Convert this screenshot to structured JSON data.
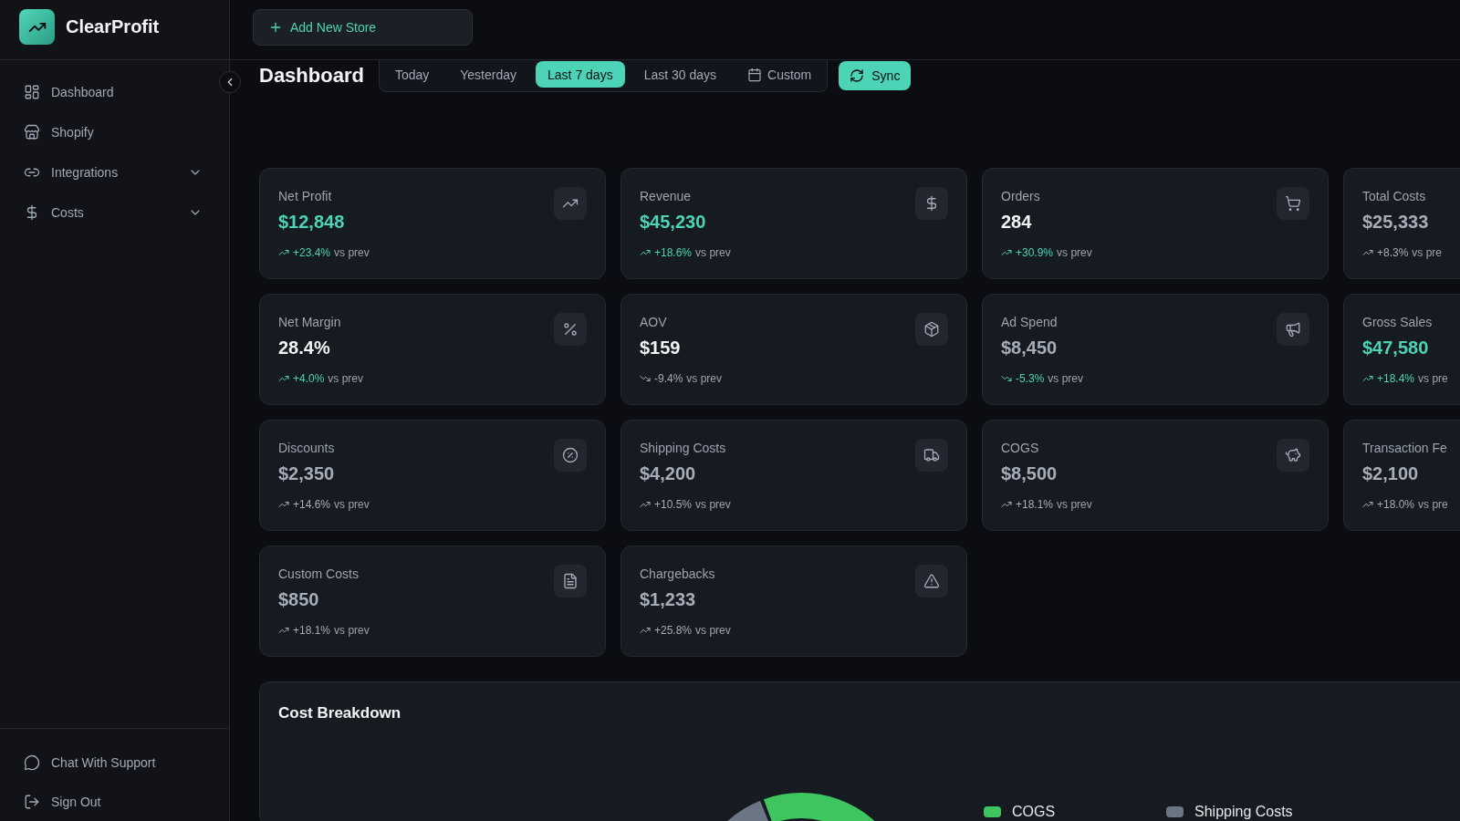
{
  "sidebar": {
    "brand": "ClearProfit",
    "nav": [
      {
        "label": "Dashboard",
        "kind": "link"
      },
      {
        "label": "Shopify",
        "kind": "link"
      },
      {
        "label": "Integrations",
        "kind": "group",
        "expanded": false
      },
      {
        "label": "Costs",
        "kind": "group",
        "expanded": false
      }
    ],
    "footer": [
      {
        "label": "Chat With Support"
      },
      {
        "label": "Sign Out"
      }
    ]
  },
  "header": {
    "add_store_button": "Add New Store"
  },
  "toolbar": {
    "title": "Dashboard",
    "ranges": [
      {
        "label": "Today",
        "kind": "preset",
        "selected": false
      },
      {
        "label": "Yesterday",
        "kind": "preset",
        "selected": false
      },
      {
        "label": "Last 7 days",
        "kind": "preset",
        "selected": true
      },
      {
        "label": "Last 30 days",
        "kind": "preset",
        "selected": false
      },
      {
        "label": "Custom",
        "kind": "custom",
        "selected": false
      }
    ],
    "sync_button": "Sync"
  },
  "metrics": [
    {
      "label": "Net Profit",
      "value": "$12,848",
      "highlighted": true,
      "dimmed": false,
      "change": "+23.4%",
      "rising": true,
      "favorable": true,
      "suffix": "vs prev"
    },
    {
      "label": "Revenue",
      "value": "$45,230",
      "highlighted": true,
      "dimmed": false,
      "change": "+18.6%",
      "rising": true,
      "favorable": true,
      "suffix": "vs prev"
    },
    {
      "label": "Orders",
      "value": "284",
      "highlighted": false,
      "dimmed": false,
      "change": "+30.9%",
      "rising": true,
      "favorable": true,
      "suffix": "vs prev"
    },
    {
      "label": "Total Costs",
      "value": "$25,333",
      "highlighted": false,
      "dimmed": true,
      "change": "+8.3%",
      "rising": true,
      "favorable": false,
      "suffix": "vs pre"
    },
    {
      "label": "Net Margin",
      "value": "28.4%",
      "highlighted": false,
      "dimmed": false,
      "change": "+4.0%",
      "rising": true,
      "favorable": true,
      "suffix": "vs prev"
    },
    {
      "label": "AOV",
      "value": "$159",
      "highlighted": false,
      "dimmed": false,
      "change": "-9.4%",
      "rising": false,
      "favorable": false,
      "suffix": "vs prev"
    },
    {
      "label": "Ad Spend",
      "value": "$8,450",
      "highlighted": false,
      "dimmed": true,
      "change": "-5.3%",
      "rising": false,
      "favorable": true,
      "suffix": "vs prev"
    },
    {
      "label": "Gross Sales",
      "value": "$47,580",
      "highlighted": true,
      "dimmed": false,
      "change": "+18.4%",
      "rising": true,
      "favorable": true,
      "suffix": "vs pre"
    },
    {
      "label": "Discounts",
      "value": "$2,350",
      "highlighted": false,
      "dimmed": true,
      "change": "+14.6%",
      "rising": true,
      "favorable": false,
      "suffix": "vs prev"
    },
    {
      "label": "Shipping Costs",
      "value": "$4,200",
      "highlighted": false,
      "dimmed": true,
      "change": "+10.5%",
      "rising": true,
      "favorable": false,
      "suffix": "vs prev"
    },
    {
      "label": "COGS",
      "value": "$8,500",
      "highlighted": false,
      "dimmed": true,
      "change": "+18.1%",
      "rising": true,
      "favorable": false,
      "suffix": "vs prev"
    },
    {
      "label": "Transaction Fe",
      "value": "$2,100",
      "highlighted": false,
      "dimmed": true,
      "change": "+18.0%",
      "rising": true,
      "favorable": false,
      "suffix": "vs pre"
    },
    {
      "label": "Custom Costs",
      "value": "$850",
      "highlighted": false,
      "dimmed": true,
      "change": "+18.1%",
      "rising": true,
      "favorable": false,
      "suffix": "vs prev"
    },
    {
      "label": "Chargebacks",
      "value": "$1,233",
      "highlighted": false,
      "dimmed": true,
      "change": "+25.8%",
      "rising": true,
      "favorable": false,
      "suffix": "vs prev"
    }
  ],
  "cost_breakdown": {
    "title": "Cost Breakdown",
    "legend": [
      {
        "label": "COGS",
        "color": "#3ec55f"
      },
      {
        "label": "Shipping Costs",
        "color": "#6b7584"
      }
    ]
  }
}
